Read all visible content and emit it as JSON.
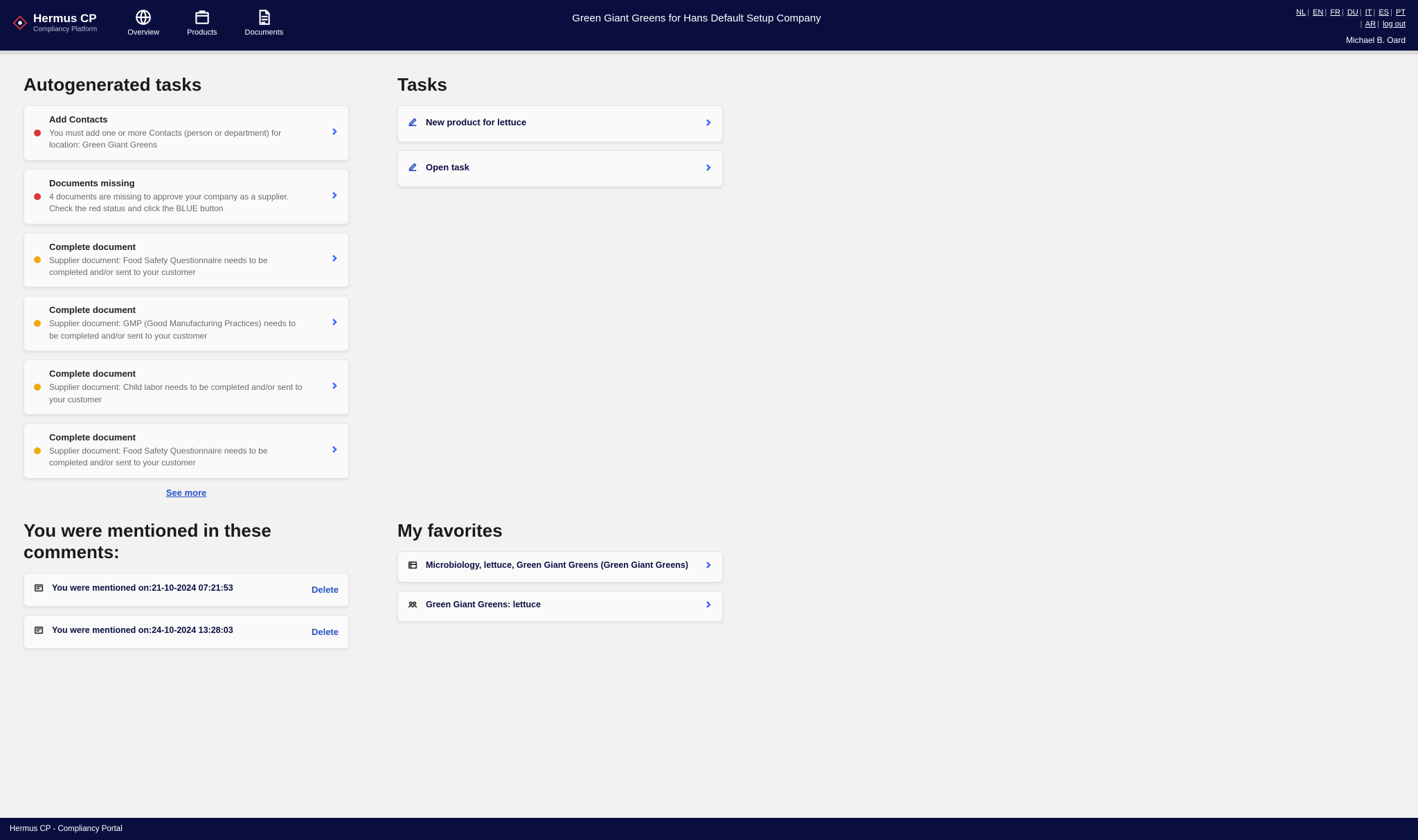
{
  "brand": {
    "title": "Hermus CP",
    "subtitle": "Compliancy Platform"
  },
  "nav": {
    "overview": "Overview",
    "products": "Products",
    "documents": "Documents"
  },
  "page_title": "Green Giant Greens for Hans Default Setup Company",
  "languages": {
    "row1": [
      "NL",
      "EN",
      "FR",
      "DU",
      "IT",
      "ES",
      "PT"
    ],
    "row2": [
      "AR",
      "log out"
    ]
  },
  "user": "Michael B. Oard",
  "autogen": {
    "heading": "Autogenerated tasks",
    "see_more": "See more",
    "items": [
      {
        "status": "red",
        "title": "Add Contacts",
        "desc": "You must add one or more Contacts (person or department) for location: Green Giant Greens"
      },
      {
        "status": "red",
        "title": "Documents missing",
        "desc": "4 documents are missing to approve your company as a supplier. Check the red status and click the BLUE button"
      },
      {
        "status": "orange",
        "title": "Complete document",
        "desc": "Supplier document: Food Safety Questionnaire needs to be completed and/or sent to your customer"
      },
      {
        "status": "orange",
        "title": "Complete document",
        "desc": "Supplier document: GMP (Good Manufacturing Practices) needs to be completed and/or sent to your customer"
      },
      {
        "status": "orange",
        "title": "Complete document",
        "desc": "Supplier document: Child labor needs to be completed and/or sent to your customer"
      },
      {
        "status": "orange",
        "title": "Complete document",
        "desc": "Supplier document: Food Safety Questionnaire needs to be completed and/or sent to your customer"
      }
    ]
  },
  "tasks": {
    "heading": "Tasks",
    "items": [
      {
        "title": "New product for lettuce"
      },
      {
        "title": "Open task"
      }
    ]
  },
  "mentions": {
    "heading": "You were mentioned in these comments:",
    "delete_label": "Delete",
    "items": [
      {
        "title": "You were mentioned on:21-10-2024 07:21:53"
      },
      {
        "title": "You were mentioned on:24-10-2024 13:28:03"
      }
    ]
  },
  "favorites": {
    "heading": "My favorites",
    "items": [
      {
        "title": "Microbiology, lettuce, Green Giant Greens (Green Giant Greens)"
      },
      {
        "title": "Green Giant Greens: lettuce"
      }
    ]
  },
  "footer": "Hermus CP - Compliancy Portal"
}
